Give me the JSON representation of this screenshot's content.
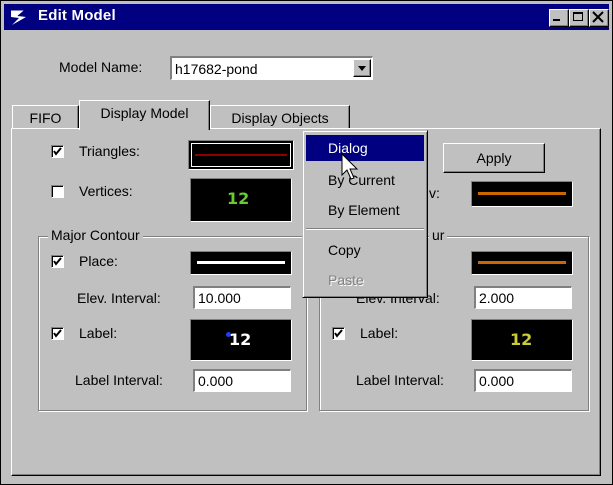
{
  "window": {
    "title": "Edit Model"
  },
  "model_name": {
    "label": "Model Name:",
    "value": "h17682-pond"
  },
  "tabs": [
    {
      "label": "FIFO"
    },
    {
      "label": "Display Model"
    },
    {
      "label": "Display Objects"
    }
  ],
  "triangles": {
    "label": "Triangles:",
    "checked": true
  },
  "vertices": {
    "label": "Vertices:",
    "checked": false,
    "swatch_text": "12"
  },
  "apply_label": "Apply",
  "partial_label_behind_menu": "v:",
  "major_contour": {
    "title": "Major Contour",
    "place_label": "Place:",
    "elev_interval_label": "Elev. Interval:",
    "elev_interval_value": "10.000",
    "label_label": "Label:",
    "label_swatch_text": "12",
    "label_interval_label": "Label Interval:",
    "label_interval_value": "0.000"
  },
  "minor_contour": {
    "title_partial": "ur",
    "elev_interval_label_partial": "Elev. Interval:",
    "elev_interval_value": "2.000",
    "label_label": "Label:",
    "label_swatch_text": "12",
    "label_interval_label": "Label Interval:",
    "label_interval_value": "0.000"
  },
  "context_menu": {
    "items": [
      {
        "label": "Dialog",
        "state": "selected"
      },
      {
        "label": "By Current",
        "state": "normal"
      },
      {
        "label": "By Element",
        "state": "normal"
      },
      {
        "label": "Copy",
        "state": "normal"
      },
      {
        "label": "Paste",
        "state": "disabled"
      }
    ]
  },
  "colors": {
    "title_bar": "#000080",
    "triangle_line": "#8b0000",
    "orange_line": "#cc6600",
    "green_label": "#66cc33",
    "yellow_label": "#cccc33"
  },
  "icons": [
    "app-logo-icon",
    "minimize-icon",
    "maximize-icon",
    "close-icon",
    "dropdown-arrow-icon",
    "checkmark-icon",
    "mouse-pointer-icon"
  ]
}
